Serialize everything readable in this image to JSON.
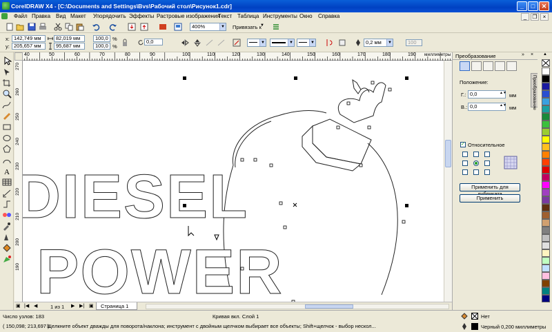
{
  "window": {
    "title": "CorelDRAW X4 - [C:\\Documents and Settings\\Bvs\\Рабочий стол\\Рисунок1.cdr]",
    "minimize": "_",
    "maximize": "□",
    "close": "✕"
  },
  "menu": {
    "items": [
      "Файл",
      "Правка",
      "Вид",
      "Макет",
      "Упорядочить",
      "Эффекты",
      "Растровые изображения",
      "Текст",
      "Таблица",
      "Инструменты",
      "Окно",
      "Справка"
    ]
  },
  "standard_toolbar": {
    "zoom": "400%",
    "snap_to": "Привязать к"
  },
  "property_bar": {
    "x_label": "x:",
    "y_label": "y:",
    "x": "142,749 мм",
    "y": "205,657 мм",
    "width": "82,019 мм",
    "height": "95,687 мм",
    "scale_x": "100,0",
    "scale_y": "100,0",
    "pct": "%",
    "rotation": "0,0",
    "outline_width": "0,2 мм",
    "disabled_value": "100"
  },
  "ruler": {
    "units": "миллиметры",
    "h_ticks": [
      "40",
      "50",
      "60",
      "70",
      "80",
      "90",
      "100",
      "110",
      "120",
      "130",
      "140",
      "150",
      "160",
      "170",
      "180",
      "190"
    ],
    "v_ticks": [
      "270",
      "260",
      "250",
      "240",
      "230",
      "220",
      "210",
      "200",
      "190"
    ]
  },
  "canvas": {
    "words": [
      "DIESEL",
      "POWER"
    ]
  },
  "page_nav": {
    "counter": "1 из 1",
    "page_tab": "Страница 1"
  },
  "docker": {
    "title": "Преобразование",
    "tab_label": "Преобразование",
    "position_label": "Положение:",
    "h_label": "Г.:",
    "v_label": "В.:",
    "h_value": "0,0",
    "v_value": "0,0",
    "unit": "мм",
    "relative_label": "Относительное",
    "apply_duplicate": "Применить для дубликата",
    "apply": "Применить"
  },
  "palette": {
    "colors": [
      "#ffffff",
      "#000000",
      "#1a1aa0",
      "#2a4fd1",
      "#3aa0e0",
      "#1aa0a0",
      "#1a8a3a",
      "#3cc03c",
      "#9acd32",
      "#ffff00",
      "#ffc020",
      "#ff8000",
      "#ff4000",
      "#e00000",
      "#c00060",
      "#ff00ff",
      "#a040c0",
      "#7a3aa0",
      "#603010",
      "#a06030",
      "#d0a070",
      "#808080",
      "#c0c0c0",
      "#e0e0e0",
      "#fff4c0",
      "#c0ffc0",
      "#c0e0ff",
      "#ffc0e0",
      "#804000",
      "#008080",
      "#000080"
    ]
  },
  "status": {
    "nodes": "Число узлов: 183",
    "object_info": "Кривая вкл. Слой 1",
    "coords": "( 150,098; 213,697 )",
    "hint": "Щелкните объект дважды для поворота/наклона; инструмент с двойным щелчком выбирает все объекты; Shift+щелчок - выбор нескол...",
    "fill_label": "Нет",
    "outline_label": "Черный  0,200 миллиметры"
  }
}
